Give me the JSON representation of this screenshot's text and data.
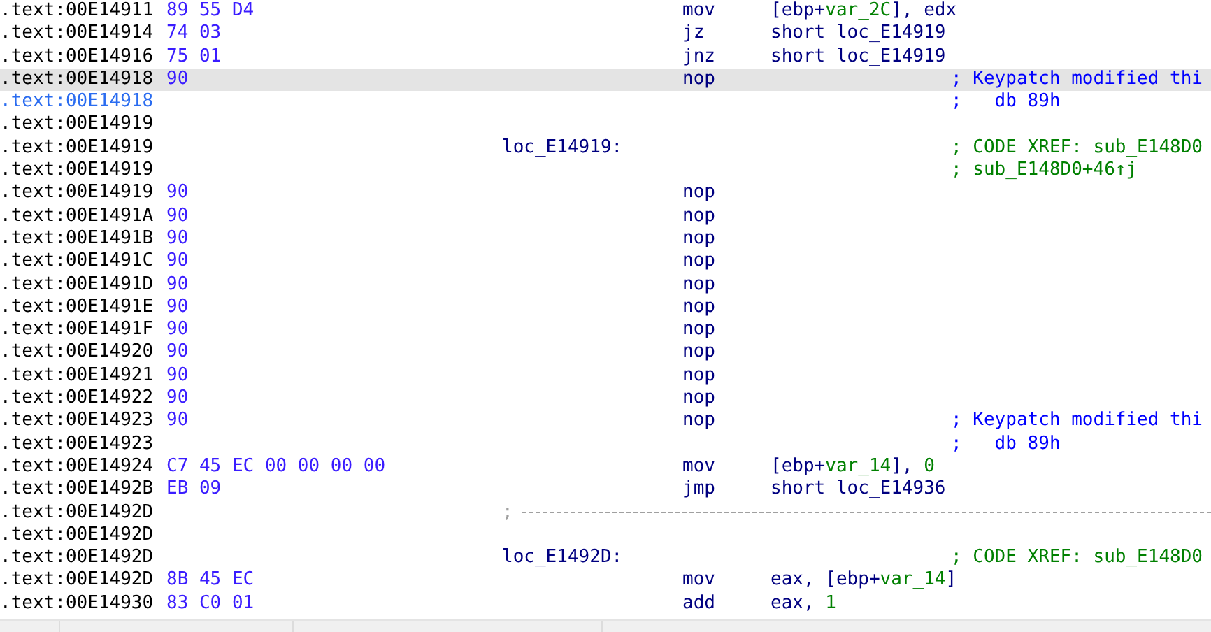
{
  "listing": [
    {
      "address": ".text:00E14911",
      "bytes": "89 55 D4",
      "mnemonic": "mov",
      "operand": [
        {
          "text": "[ebp+",
          "kind": "plain"
        },
        {
          "text": "var_2C",
          "kind": "var"
        },
        {
          "text": "], edx",
          "kind": "plain"
        }
      ],
      "selected": false,
      "address_highlighted": false
    },
    {
      "address": ".text:00E14914",
      "bytes": "74 03",
      "mnemonic": "jz",
      "operand": [
        {
          "text": "short loc_E14919",
          "kind": "plain"
        }
      ],
      "selected": false,
      "address_highlighted": false
    },
    {
      "address": ".text:00E14916",
      "bytes": "75 01",
      "mnemonic": "jnz",
      "operand": [
        {
          "text": "short loc_E14919",
          "kind": "plain"
        }
      ],
      "selected": false,
      "address_highlighted": false
    },
    {
      "address": ".text:00E14918",
      "bytes": "90",
      "mnemonic": "nop",
      "comment": {
        "text": "; Keypatch modified thi",
        "kind": "patch"
      },
      "selected": true,
      "address_highlighted": false
    },
    {
      "address": ".text:00E14918",
      "comment": {
        "text": ";   db 89h",
        "kind": "patch"
      },
      "selected": false,
      "address_highlighted": true
    },
    {
      "address": ".text:00E14919",
      "selected": false,
      "address_highlighted": false
    },
    {
      "address": ".text:00E14919",
      "label": "loc_E14919:",
      "comment": {
        "text": "; CODE XREF: sub_E148D0",
        "kind": "xref"
      },
      "selected": false,
      "address_highlighted": false
    },
    {
      "address": ".text:00E14919",
      "comment": {
        "text": "; sub_E148D0+46↑j",
        "kind": "xref"
      },
      "selected": false,
      "address_highlighted": false
    },
    {
      "address": ".text:00E14919",
      "bytes": "90",
      "mnemonic": "nop",
      "selected": false,
      "address_highlighted": false
    },
    {
      "address": ".text:00E1491A",
      "bytes": "90",
      "mnemonic": "nop",
      "selected": false,
      "address_highlighted": false
    },
    {
      "address": ".text:00E1491B",
      "bytes": "90",
      "mnemonic": "nop",
      "selected": false,
      "address_highlighted": false
    },
    {
      "address": ".text:00E1491C",
      "bytes": "90",
      "mnemonic": "nop",
      "selected": false,
      "address_highlighted": false
    },
    {
      "address": ".text:00E1491D",
      "bytes": "90",
      "mnemonic": "nop",
      "selected": false,
      "address_highlighted": false
    },
    {
      "address": ".text:00E1491E",
      "bytes": "90",
      "mnemonic": "nop",
      "selected": false,
      "address_highlighted": false
    },
    {
      "address": ".text:00E1491F",
      "bytes": "90",
      "mnemonic": "nop",
      "selected": false,
      "address_highlighted": false
    },
    {
      "address": ".text:00E14920",
      "bytes": "90",
      "mnemonic": "nop",
      "selected": false,
      "address_highlighted": false
    },
    {
      "address": ".text:00E14921",
      "bytes": "90",
      "mnemonic": "nop",
      "selected": false,
      "address_highlighted": false
    },
    {
      "address": ".text:00E14922",
      "bytes": "90",
      "mnemonic": "nop",
      "selected": false,
      "address_highlighted": false
    },
    {
      "address": ".text:00E14923",
      "bytes": "90",
      "mnemonic": "nop",
      "comment": {
        "text": "; Keypatch modified thi",
        "kind": "patch"
      },
      "selected": false,
      "address_highlighted": false
    },
    {
      "address": ".text:00E14923",
      "comment": {
        "text": ";   db 89h",
        "kind": "patch"
      },
      "selected": false,
      "address_highlighted": false
    },
    {
      "address": ".text:00E14924",
      "bytes": "C7 45 EC 00 00 00 00",
      "mnemonic": "mov",
      "operand": [
        {
          "text": "[ebp+",
          "kind": "plain"
        },
        {
          "text": "var_14",
          "kind": "var"
        },
        {
          "text": "], ",
          "kind": "plain"
        },
        {
          "text": "0",
          "kind": "num"
        }
      ],
      "selected": false,
      "address_highlighted": false
    },
    {
      "address": ".text:00E1492B",
      "bytes": "EB 09",
      "mnemonic": "jmp",
      "operand": [
        {
          "text": "short loc_E14936",
          "kind": "plain"
        }
      ],
      "selected": false,
      "address_highlighted": false
    },
    {
      "address": ".text:00E1492D",
      "separator": ";",
      "selected": false,
      "address_highlighted": false
    },
    {
      "address": ".text:00E1492D",
      "selected": false,
      "address_highlighted": false
    },
    {
      "address": ".text:00E1492D",
      "label": "loc_E1492D:",
      "comment": {
        "text": "; CODE XREF: sub_E148D0",
        "kind": "xref"
      },
      "selected": false,
      "address_highlighted": false
    },
    {
      "address": ".text:00E1492D",
      "bytes": "8B 45 EC",
      "mnemonic": "mov",
      "operand": [
        {
          "text": "eax, [ebp+",
          "kind": "plain"
        },
        {
          "text": "var_14",
          "kind": "var"
        },
        {
          "text": "]",
          "kind": "plain"
        }
      ],
      "selected": false,
      "address_highlighted": false
    },
    {
      "address": ".text:00E14930",
      "bytes": "83 C0 01",
      "mnemonic": "add",
      "operand": [
        {
          "text": "eax, ",
          "kind": "plain"
        },
        {
          "text": "1",
          "kind": "num"
        }
      ],
      "selected": false,
      "address_highlighted": false
    }
  ]
}
